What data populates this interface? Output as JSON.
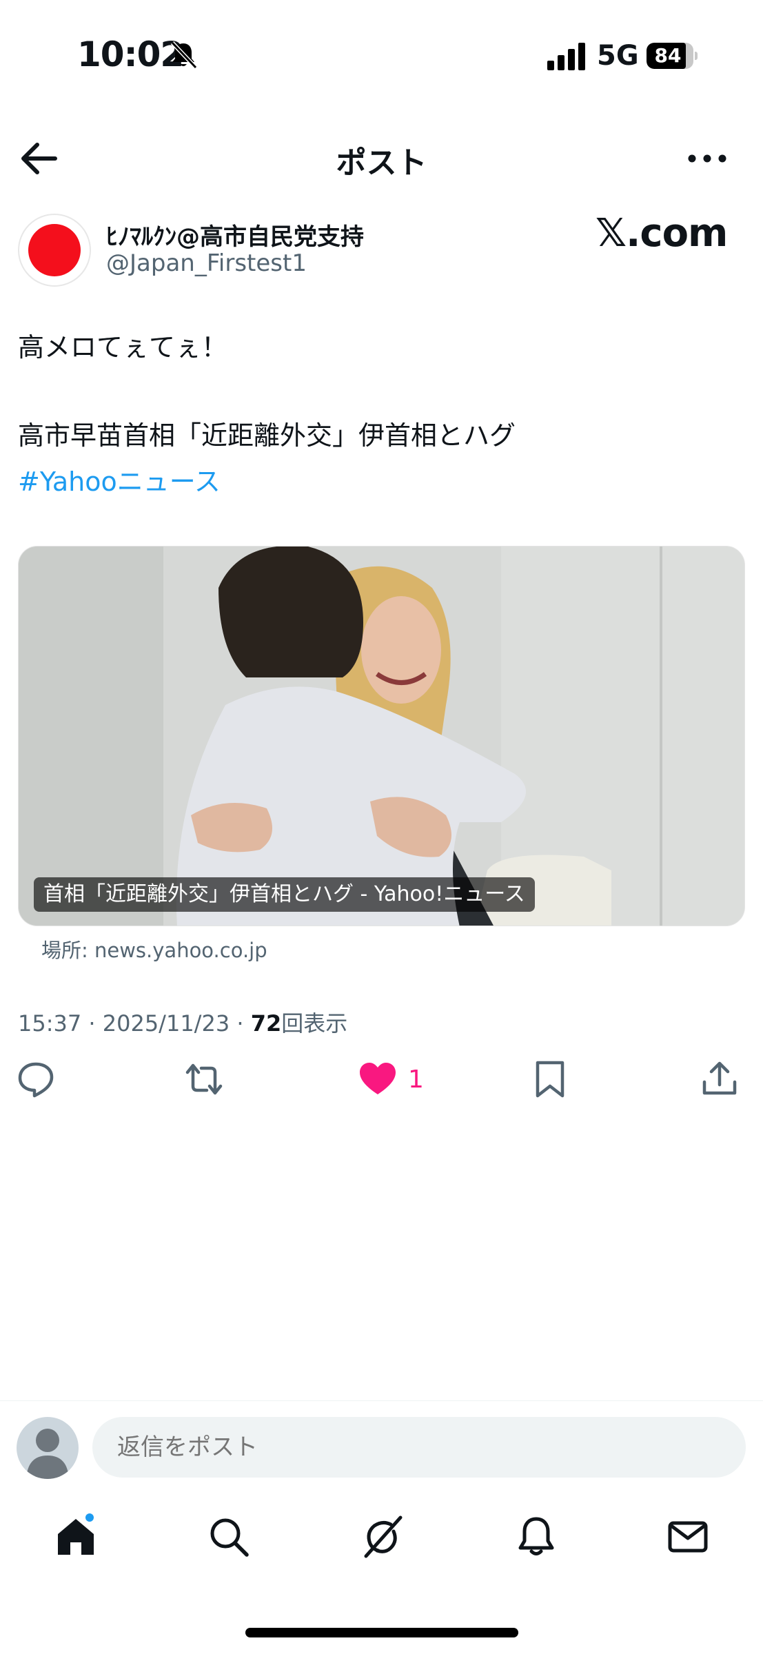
{
  "status_bar": {
    "time": "10:02",
    "network": "5G",
    "battery": "84",
    "battery_level_percent": 84
  },
  "header": {
    "title": "ポスト"
  },
  "author": {
    "display_name": "ﾋﾉﾏﾙｸﾝ@高市自民党支持",
    "handle": "@Japan_Firstest1",
    "badge_text": "𝕏.com"
  },
  "post": {
    "line1": "高メロてぇてぇ！",
    "line2": "高市早苗首相「近距離外交」伊首相とハグ",
    "hashtag": "#Yahooニュース"
  },
  "card": {
    "caption": "首相「近距離外交」伊首相とハグ - Yahoo!ニュース",
    "source": "場所: news.yahoo.co.jp"
  },
  "meta": {
    "time": "15:37",
    "date": "2025/11/23",
    "views": "72",
    "views_label": "回表示",
    "separator": "·"
  },
  "actions": {
    "like_count": "1"
  },
  "reply": {
    "placeholder": "返信をポスト"
  },
  "colors": {
    "accent": "#1d9bf0",
    "like": "#f91880",
    "flag_red": "#f40f1c",
    "secondary_text": "#536471"
  }
}
